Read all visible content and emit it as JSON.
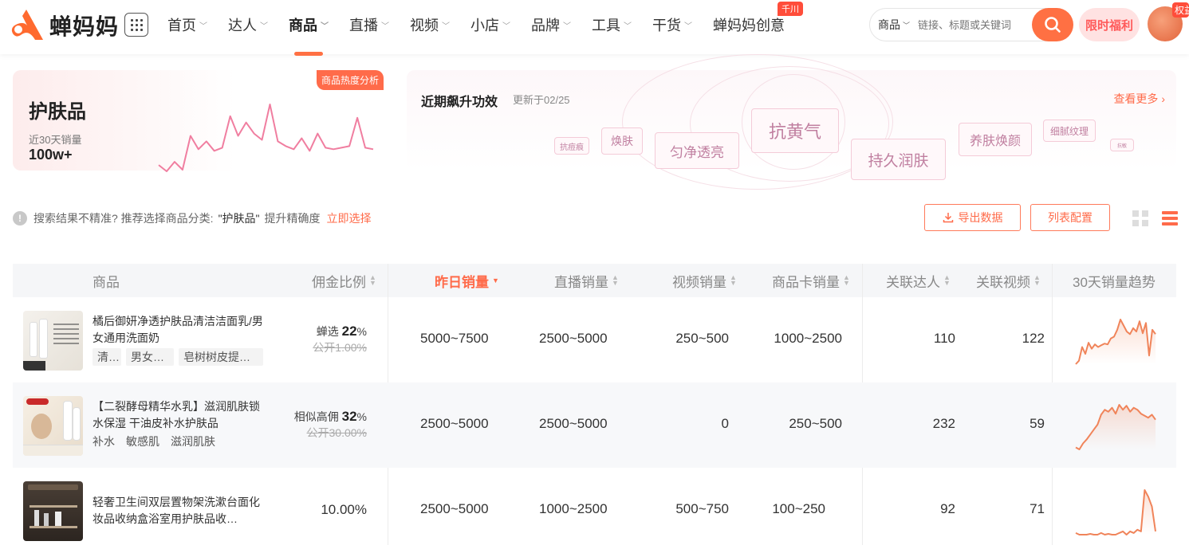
{
  "nav": {
    "logo_text": "蝉妈妈",
    "menu": [
      {
        "label": "首页",
        "chevron": true,
        "active": false
      },
      {
        "label": "达人",
        "chevron": true,
        "active": false
      },
      {
        "label": "商品",
        "chevron": true,
        "active": true
      },
      {
        "label": "直播",
        "chevron": true,
        "active": false
      },
      {
        "label": "视频",
        "chevron": true,
        "active": false
      },
      {
        "label": "小店",
        "chevron": true,
        "active": false
      },
      {
        "label": "品牌",
        "chevron": true,
        "active": false
      },
      {
        "label": "工具",
        "chevron": true,
        "active": false
      },
      {
        "label": "干货",
        "chevron": true,
        "active": false
      },
      {
        "label": "蝉妈妈创意",
        "chevron": false,
        "active": false
      }
    ],
    "creative_badge": "千川",
    "search_category": "商品",
    "search_placeholder": "链接、标题或关键词",
    "promo_label": "限时福利",
    "avatar_badge": "权益"
  },
  "heat_card": {
    "tag": "商品热度分析",
    "title": "护肤品",
    "sales_label": "近30天销量",
    "sales_value": "100w+",
    "trend": [
      18,
      10,
      22,
      12,
      55,
      38,
      48,
      36,
      40,
      80,
      55,
      72,
      58,
      50,
      95,
      48,
      42,
      38,
      52,
      36,
      58,
      40,
      38,
      40,
      42,
      78,
      40,
      38
    ]
  },
  "effects": {
    "title": "近期飙升功效",
    "updated": "更新于02/25",
    "more": "查看更多",
    "words": [
      "抗黄气",
      "匀净透亮",
      "持久润肤",
      "焕肤",
      "养肤焕颜",
      "细腻纹理",
      "抗痘痕",
      "抗敏"
    ]
  },
  "hint": {
    "prefix": "搜索结果不精准? 推荐选择商品分类:",
    "category": "\"护肤品\"",
    "suffix": "提升精确度",
    "link": "立即选择"
  },
  "actions": {
    "export": "导出数据",
    "columns": "列表配置"
  },
  "table": {
    "headers": {
      "product": "商品",
      "commission": "佣金比例",
      "yesterday": "昨日销量",
      "live": "直播销量",
      "video": "视频销量",
      "card": "商品卡销量",
      "creators": "关联达人",
      "videos": "关联视频",
      "trend": "30天销量趋势"
    },
    "rows": [
      {
        "name": "橘后御妍净透护肤品清洁洁面乳/男女通用洗面奶",
        "tags": [
          "清…",
          "男女…",
          "皂树树皮提…"
        ],
        "commission_prefix": "蝉选",
        "commission": "22",
        "commission_unit": "%",
        "commission_public": "公开1.00%",
        "yesterday": "5000~7500",
        "live": "2500~5000",
        "video": "250~500",
        "card": "1000~2500",
        "creators": "110",
        "videos": "122",
        "trend": [
          10,
          14,
          30,
          22,
          35,
          28,
          33,
          30,
          32,
          34,
          33,
          40,
          42,
          50,
          62,
          55,
          48,
          45,
          52,
          48,
          60,
          46,
          58,
          20,
          50,
          45
        ]
      },
      {
        "name": "【二裂酵母精华水乳】滋润肌肤锁水保湿 干油皮补水护肤品",
        "tags": [
          "补水",
          "敏感肌",
          "滋润肌肤"
        ],
        "commission_prefix": "相似高佣",
        "commission": "32",
        "commission_unit": "%",
        "commission_public": "公开30.00%",
        "yesterday": "2500~5000",
        "live": "2500~5000",
        "video": "0",
        "card": "250~500",
        "creators": "232",
        "videos": "59",
        "trend": [
          12,
          10,
          16,
          20,
          25,
          30,
          35,
          45,
          50,
          48,
          52,
          46,
          55,
          50,
          54,
          48,
          52,
          50,
          46,
          44,
          42,
          45,
          40
        ]
      },
      {
        "name": "轻奢卫生间双层置物架洗漱台面化妆品收纳盒浴室用护肤品收…",
        "tags": [],
        "commission_prefix": "",
        "commission": "",
        "commission_unit": "",
        "commission_public": "",
        "commission_plain": "10.00%",
        "yesterday": "2500~5000",
        "live": "1000~2500",
        "video": "500~750",
        "card": "100~250",
        "creators": "92",
        "videos": "71",
        "trend": [
          8,
          6,
          6,
          6,
          7,
          6,
          6,
          8,
          6,
          7,
          6,
          6,
          8,
          10,
          6,
          10,
          8,
          12,
          10,
          60,
          52,
          40,
          10
        ]
      }
    ]
  },
  "colors": {
    "accent": "#ff7043",
    "trend_line": "#f07ea0",
    "spark": "#f0845a"
  }
}
